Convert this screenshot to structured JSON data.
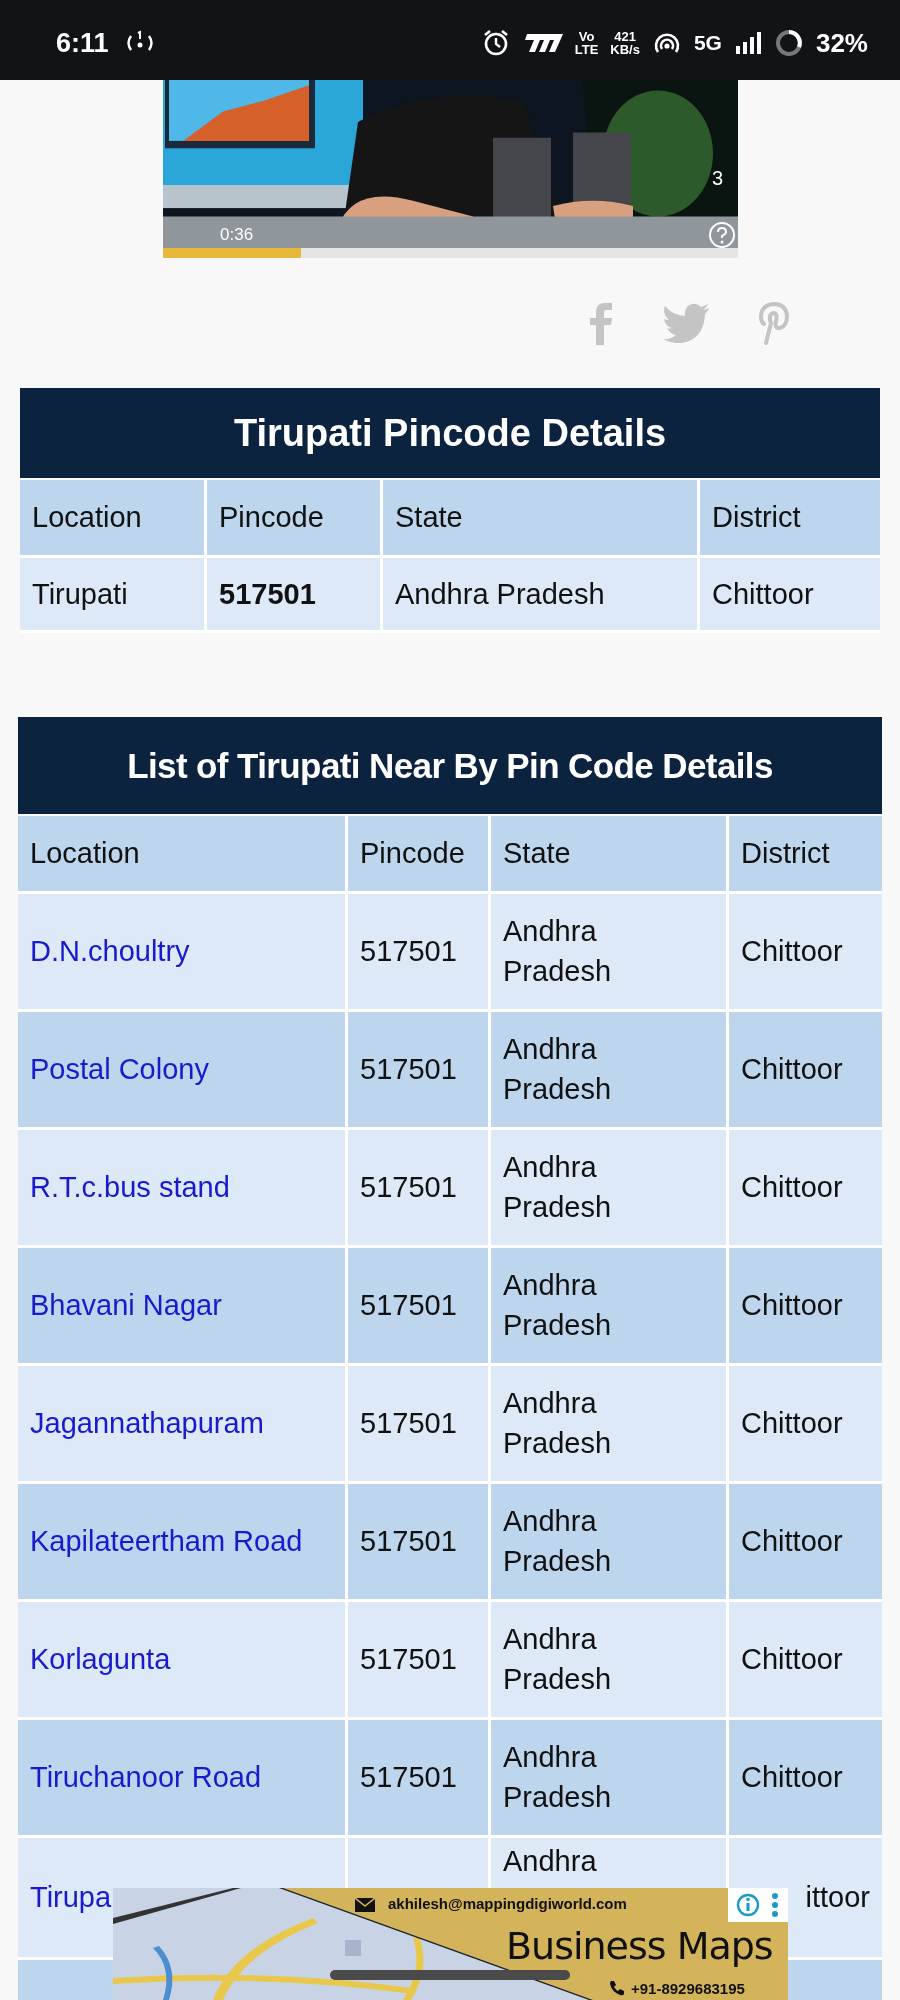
{
  "status_bar": {
    "time": "6:11",
    "volte_top": "Vo",
    "volte_bottom": "LTE",
    "speed_value": "421",
    "speed_unit": "KB/s",
    "network_type": "5G",
    "battery": "32%"
  },
  "video": {
    "kind": "picture",
    "time": "0:36",
    "counter": "3",
    "level": 0.24
  },
  "pincode_table": {
    "title": "Tirupati Pincode Details",
    "columns": [
      "Location",
      "Pincode",
      "State",
      "District"
    ],
    "rows": [
      {
        "location": "Tirupati",
        "pincode": "517501",
        "state": "Andhra Pradesh",
        "district": "Chittoor"
      }
    ]
  },
  "nearby_table": {
    "title": "List of Tirupati Near By Pin Code Details",
    "columns": [
      "Location",
      "Pincode",
      "State",
      "District"
    ],
    "rows": [
      {
        "location": "D.N.choultry",
        "pincode": "517501",
        "state": "Andhra Pradesh",
        "district": "Chittoor",
        "partial": false
      },
      {
        "location": "Postal Colony",
        "pincode": "517501",
        "state": "Andhra Pradesh",
        "district": "Chittoor",
        "partial": false
      },
      {
        "location": "R.T.c.bus stand",
        "pincode": "517501",
        "state": "Andhra Pradesh",
        "district": "Chittoor",
        "partial": false
      },
      {
        "location": "Bhavani Nagar",
        "pincode": "517501",
        "state": "Andhra Pradesh",
        "district": "Chittoor",
        "partial": false
      },
      {
        "location": "Jagannathapuram",
        "pincode": "517501",
        "state": "Andhra Pradesh",
        "district": "Chittoor",
        "partial": false
      },
      {
        "location": "Kapilateertham Road",
        "pincode": "517501",
        "state": "Andhra Pradesh",
        "district": "Chittoor",
        "partial": false
      },
      {
        "location": "Korlagunta",
        "pincode": "517501",
        "state": "Andhra Pradesh",
        "district": "Chittoor",
        "partial": false
      },
      {
        "location": "Tiruchanoor Road",
        "pincode": "517501",
        "state": "Andhra Pradesh",
        "district": "Chittoor",
        "partial": false
      },
      {
        "location": "Tirupa",
        "state": "Andhra",
        "district": "ittoor",
        "partial": true
      }
    ]
  },
  "ad": {
    "email": "akhilesh@mappingdigiworld.com",
    "headline": "Business Maps",
    "phone": "+91-8929683195"
  }
}
